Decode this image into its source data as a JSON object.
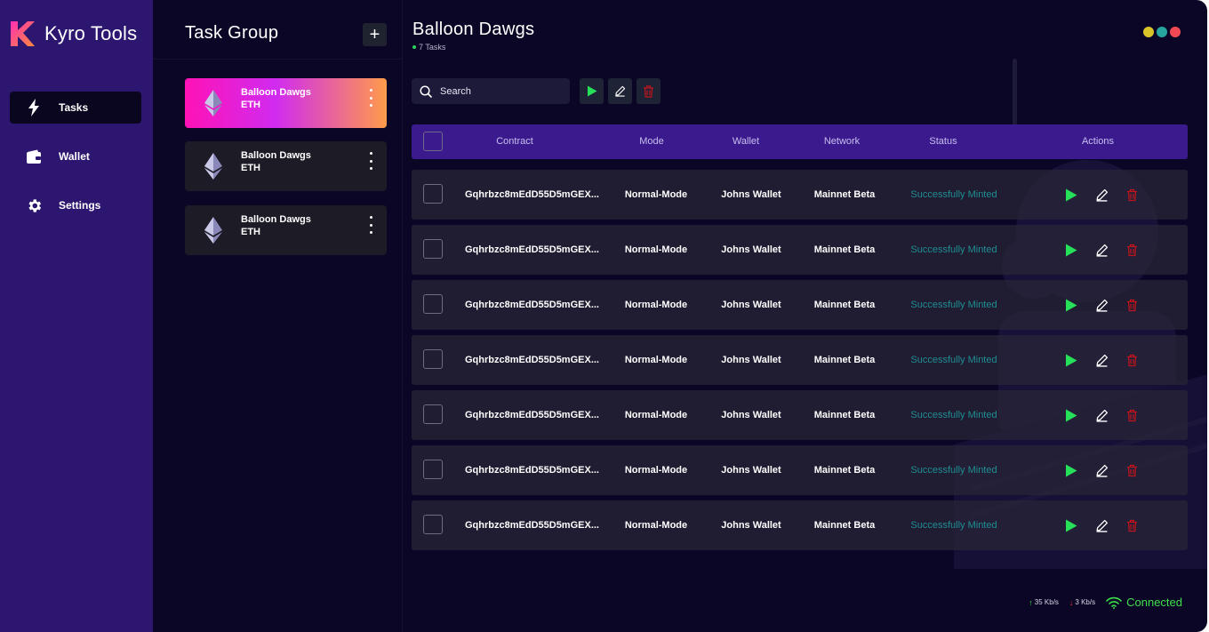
{
  "app": {
    "name": "Kyro Tools"
  },
  "colors": {
    "sidebar": "#2d1670",
    "background": "#0c0626",
    "accent_green": "#27e05a",
    "danger_red": "#c3141c",
    "status_teal": "#1f8f92",
    "table_header": "#3a1a8c"
  },
  "sidebar": {
    "items": [
      {
        "label": "Tasks",
        "icon": "lightning-icon",
        "active": true
      },
      {
        "label": "Wallet",
        "icon": "wallet-icon",
        "active": false
      },
      {
        "label": "Settings",
        "icon": "gear-icon",
        "active": false
      }
    ]
  },
  "task_groups": {
    "title": "Task Group",
    "add_label": "+",
    "items": [
      {
        "name": "Balloon Dawgs",
        "chain": "ETH",
        "active": true
      },
      {
        "name": "Balloon Dawgs",
        "chain": "ETH",
        "active": false
      },
      {
        "name": "Balloon Dawgs",
        "chain": "ETH",
        "active": false
      }
    ]
  },
  "main": {
    "title": "Balloon Dawgs",
    "task_count": "7 Tasks",
    "window_dots": [
      "#d8c52a",
      "#27a6a0",
      "#ef4955"
    ],
    "search": {
      "placeholder": "Search"
    }
  },
  "table": {
    "columns": [
      "Contract",
      "Mode",
      "Wallet",
      "Network",
      "Status",
      "Actions"
    ],
    "rows": [
      {
        "contract": "Gqhrbzc8mEdD55D5mGEX...",
        "mode": "Normal-Mode",
        "wallet": "Johns Wallet",
        "network": "Mainnet Beta",
        "status": "Successfully Minted"
      },
      {
        "contract": "Gqhrbzc8mEdD55D5mGEX...",
        "mode": "Normal-Mode",
        "wallet": "Johns Wallet",
        "network": "Mainnet Beta",
        "status": "Successfully Minted"
      },
      {
        "contract": "Gqhrbzc8mEdD55D5mGEX...",
        "mode": "Normal-Mode",
        "wallet": "Johns Wallet",
        "network": "Mainnet Beta",
        "status": "Successfully Minted"
      },
      {
        "contract": "Gqhrbzc8mEdD55D5mGEX...",
        "mode": "Normal-Mode",
        "wallet": "Johns Wallet",
        "network": "Mainnet Beta",
        "status": "Successfully Minted"
      },
      {
        "contract": "Gqhrbzc8mEdD55D5mGEX...",
        "mode": "Normal-Mode",
        "wallet": "Johns Wallet",
        "network": "Mainnet Beta",
        "status": "Successfully Minted"
      },
      {
        "contract": "Gqhrbzc8mEdD55D5mGEX...",
        "mode": "Normal-Mode",
        "wallet": "Johns Wallet",
        "network": "Mainnet Beta",
        "status": "Successfully Minted"
      },
      {
        "contract": "Gqhrbzc8mEdD55D5mGEX...",
        "mode": "Normal-Mode",
        "wallet": "Johns Wallet",
        "network": "Mainnet Beta",
        "status": "Successfully Minted"
      }
    ]
  },
  "status_bar": {
    "upload": "35 Kb/s",
    "download": "3 Kb/s",
    "connection": "Connected"
  }
}
